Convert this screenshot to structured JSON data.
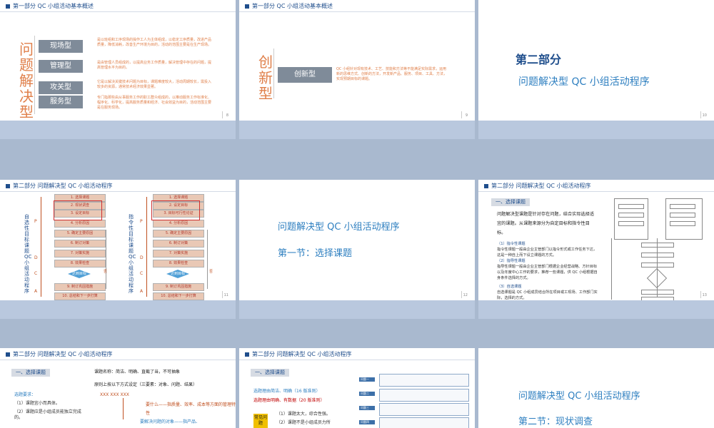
{
  "slides": {
    "s8": {
      "header": "第一部分    QC 小组活动基本概述",
      "vertical": "问题解决型",
      "types": [
        "现场型",
        "管理型",
        "攻关型",
        "服务型"
      ],
      "descs": [
        "是以班组和工序现场的操作工人为主体组成，以稳定工序质量，改进产品质量，降低消耗，改善生产环境为目的，活动的范围主要是在生产现场。",
        "是由管理人员组成的，以提高业务工作质量，解决管理中存在的问题，提高管理水平为目的。",
        "它是以解决关键技术问题为目标，课题难度较大，活动周期较长，需投入较多的资源，通常技术经济效果显著。",
        "专门指那些由从事服务工作的职工群众组成的，以推动服务工作标准化、程序化、科学化，提高服务质量和经济、社会效益为目的，活动范围主要是在服务现场。"
      ],
      "page": "8"
    },
    "s9": {
      "header": "第一部分    QC 小组活动基本概述",
      "vertical": "创新型",
      "box": "创新型",
      "desc": "QC 小组针对现有技术、工艺、技能和方法等不能满足实际需求，运用新的思维方式、创新的方法，开发新产品、服务、项目、工具、方法，实现预期目标的课题。",
      "page": "9"
    },
    "s10": {
      "title": "第二部分",
      "subtitle": "问题解决型 QC 小组活动程序",
      "page": "10"
    },
    "s11": {
      "header": "第二部分   问题解决型 QC 小组活动程序",
      "left_label": "自选性目标课题QC小组活动程序",
      "right_label": "指令性目标课题QC小组活动程序",
      "left_steps": [
        "1. 选择课题",
        "2. 现状调查",
        "3. 设定目标",
        "4. 分析原因",
        "5. 确定主要原因",
        "6. 制订对策",
        "7. 对策实施",
        "8. 效果检查",
        "达到目标",
        "9. 制订巩固措施",
        "10. 总结和下一步打算"
      ],
      "right_steps": [
        "1. 选择课题",
        "2. 设定目标",
        "3. 目标可行性论证",
        "4. 分析原因",
        "5. 确定主要原因",
        "6. 制订对策",
        "7. 对策实施",
        "8. 效果检查",
        "达到目标",
        "9. 制订巩固措施",
        "10. 总结和下一步打算"
      ],
      "pdca": [
        "P",
        "D",
        "C",
        "A"
      ],
      "no_label": "否",
      "page": "11"
    },
    "s12": {
      "title": "问题解决型 QC 小组活动程序",
      "subtitle": "第一节：选择课题",
      "page": "12"
    },
    "s13": {
      "header": "第二部分   问题解决型 QC 小组活动程序",
      "tag": "一、选择课题",
      "p1": "问题解决型课题是针对存在问题，结合实际选择适宜的课题。从课题来源分为自定目标和指令性目标。",
      "items": [
        "（1）指令性课题",
        "指令性课题一般由企业主管部门以指令形式或工作任务下达，这是一种自上而下设立课题的方式。",
        "（2）指导性课题",
        "指导性课题一般由企业主管部门根据企业经营战略、方针目标以及年度中心工作的要求，推荐一些课题，供 QC 小组根据自身条件选择的方式。",
        "（3）自选课题",
        "自选课题是 QC 小组成员结合所在项目或工现场、工作部门实际，选择的方式。"
      ],
      "page": "13"
    },
    "s14": {
      "header": "第二部分   问题解决型 QC 小组活动程序",
      "tag": "一、选择课题",
      "name_line": "课题名称：简洁、明确、直截了当，不可抽象",
      "principle": "原则上按以下方式设定（三要素：对象、问题、结果）",
      "xxx": "XXX  XXX  XXX",
      "req_title": "选题要求：",
      "req1": "（1）课题宜小而具体。",
      "req2": "（2）课题应是小组成员能独立完成的。",
      "what": "要什么——指质量、效率、成本等方面的管理特性",
      "solve": "要解决问题的对象——指产品、"
    },
    "s15": {
      "header": "第二部分   问题解决型 QC 小组活动程序",
      "tag": "一、选择课题",
      "blue": "选题理由简洁、明确（16 版准则）",
      "red": "选题理由明确、有数据（20 版准则）",
      "badge": "常见问题",
      "p1": "（1）课题太大，综合性强。",
      "p2": "（2）课题不是小组成员力所",
      "box_labels": [
        "问题一",
        "问题二",
        "问题三",
        "问题四"
      ]
    },
    "s16": {
      "title": "问题解决型 QC 小组活动程序",
      "subtitle": "第二节：现状调查"
    }
  }
}
